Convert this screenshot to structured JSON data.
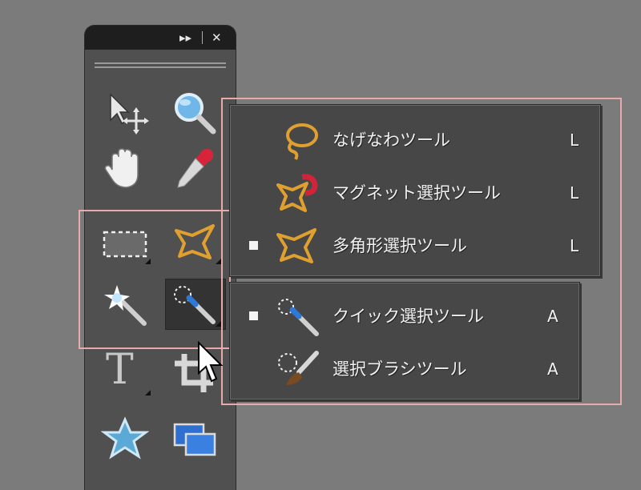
{
  "panel": {
    "expand_label": "▸▸",
    "close_label": "✕",
    "tools": [
      {
        "id": "move",
        "icon": "move-tool-icon"
      },
      {
        "id": "zoom",
        "icon": "zoom-tool-icon"
      },
      {
        "id": "hand",
        "icon": "hand-tool-icon"
      },
      {
        "id": "eyedropper",
        "icon": "eyedropper-tool-icon"
      },
      {
        "id": "marquee",
        "icon": "rectangular-marquee-icon"
      },
      {
        "id": "polygonal-lasso",
        "icon": "polygonal-lasso-icon"
      },
      {
        "id": "magic-wand",
        "icon": "magic-wand-icon"
      },
      {
        "id": "quick-selection",
        "icon": "quick-selection-icon",
        "active": true
      },
      {
        "id": "type",
        "icon": "type-tool-icon",
        "label": "T"
      },
      {
        "id": "crop",
        "icon": "crop-tool-icon"
      },
      {
        "id": "shape",
        "icon": "custom-shape-icon"
      },
      {
        "id": "recompose",
        "icon": "recompose-tool-icon"
      }
    ]
  },
  "lasso_menu": {
    "items": [
      {
        "label": "なげなわツール",
        "key": "L",
        "selected": false,
        "icon": "lasso-icon"
      },
      {
        "label": "マグネット選択ツール",
        "key": "L",
        "selected": false,
        "icon": "magnetic-lasso-icon"
      },
      {
        "label": "多角形選択ツール",
        "key": "L",
        "selected": true,
        "icon": "polygonal-lasso-icon"
      }
    ]
  },
  "selection_menu": {
    "items": [
      {
        "label": "クイック選択ツール",
        "key": "A",
        "selected": true,
        "icon": "quick-selection-icon"
      },
      {
        "label": "選択ブラシツール",
        "key": "A",
        "selected": false,
        "icon": "selection-brush-icon"
      }
    ]
  },
  "colors": {
    "background": "#7b7b7b",
    "panel": "#505050",
    "header": "#1e1e1e",
    "menu": "#474747",
    "highlight": "#e8aaaa",
    "lasso_orange": "#e0a030"
  }
}
